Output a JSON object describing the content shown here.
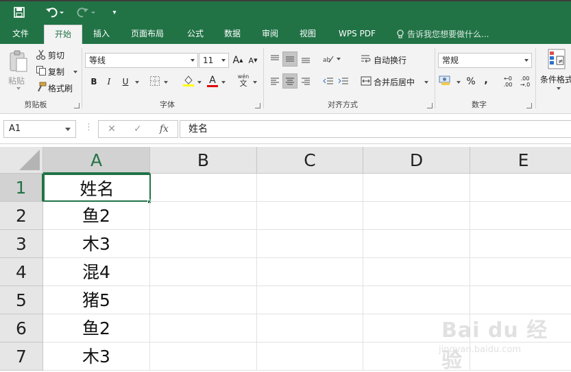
{
  "titlebar": {
    "qat_save": "save-icon",
    "qat_undo": "undo-icon",
    "qat_redo": "redo-icon",
    "qat_customize": "▾"
  },
  "tabs": {
    "items": [
      "文件",
      "开始",
      "插入",
      "页面布局",
      "公式",
      "数据",
      "审阅",
      "视图",
      "WPS PDF"
    ],
    "active": "开始",
    "tell_me": "告诉我您想要做什么..."
  },
  "ribbon": {
    "clipboard": {
      "paste": "粘贴",
      "cut": "剪切",
      "copy": "复制",
      "format_painter": "格式刷",
      "label": "剪贴板"
    },
    "font": {
      "font_name": "等线",
      "font_size": "11",
      "grow": "A",
      "shrink": "A",
      "bold": "B",
      "italic": "I",
      "underline": "U",
      "phonetic": "wén",
      "phonetic_char": "文",
      "font_color_letter": "A",
      "label": "字体"
    },
    "alignment": {
      "wrap_text": "自动换行",
      "merge_center": "合并后居中",
      "label": "对齐方式"
    },
    "number": {
      "format": "常规",
      "percent": "%",
      "comma": ",",
      "inc_decimal_top": "←0",
      "inc_decimal_bottom": ".00",
      "dec_decimal_top": ".00",
      "dec_decimal_bottom": "→.0",
      "label": "数字"
    },
    "styles": {
      "conditional_formatting": "条件格式"
    }
  },
  "formula_bar": {
    "name_box": "A1",
    "dots": "⋮",
    "cancel": "✕",
    "enter": "✓",
    "fx": "fx",
    "content": "姓名"
  },
  "sheet": {
    "columns": [
      "A",
      "B",
      "C",
      "D",
      "E"
    ],
    "rows": [
      "1",
      "2",
      "3",
      "4",
      "5",
      "6",
      "7"
    ],
    "colA": [
      "姓名",
      "鱼2",
      "木3",
      "混4",
      "猪5",
      "鱼2",
      "木3"
    ],
    "active_cell": "A1"
  },
  "watermark": {
    "text": "Bai du 经验",
    "sub": "jingyan.baidu.com"
  },
  "colors": {
    "accent": "#217346",
    "ribbon_bg": "#f3f3f3",
    "header_bg": "#e6e6e6"
  }
}
